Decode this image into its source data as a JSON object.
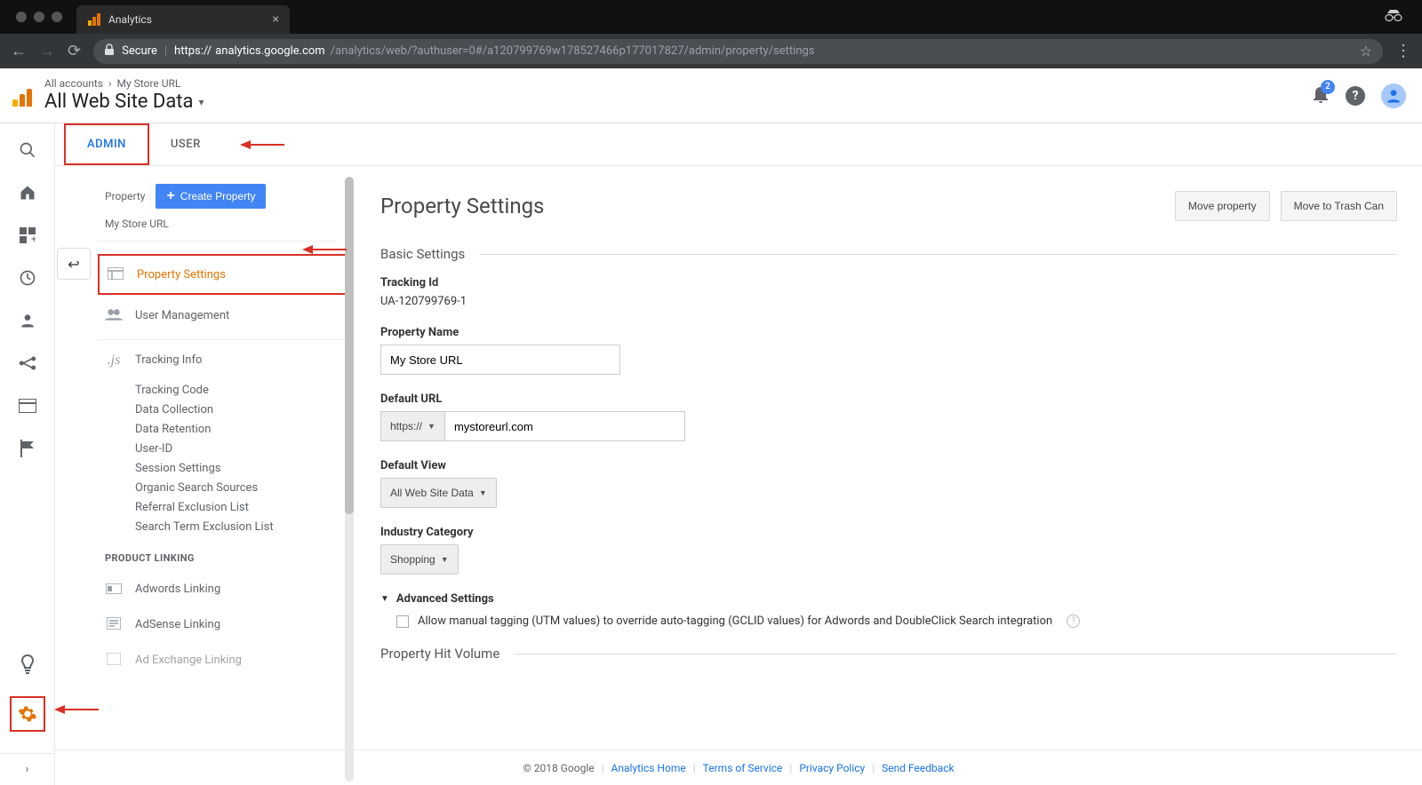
{
  "browser": {
    "tab_title": "Analytics",
    "secure_label": "Secure",
    "url_prefix": "https://",
    "url_host": "analytics.google.com",
    "url_path": "/analytics/web/?authuser=0#/a120799769w178527466p177017827/admin/property/settings"
  },
  "header": {
    "breadcrumb_accounts": "All accounts",
    "breadcrumb_property": "My Store URL",
    "view_name": "All Web Site Data",
    "notif_count": "2"
  },
  "tabs": {
    "admin": "ADMIN",
    "user": "USER"
  },
  "property_col": {
    "label": "Property",
    "create_btn": "Create Property",
    "property_name": "My Store URL",
    "menu": {
      "property_settings": "Property Settings",
      "user_management": "User Management",
      "tracking_info": "Tracking Info",
      "tracking_sub": [
        "Tracking Code",
        "Data Collection",
        "Data Retention",
        "User-ID",
        "Session Settings",
        "Organic Search Sources",
        "Referral Exclusion List",
        "Search Term Exclusion List"
      ],
      "section_product_linking": "PRODUCT LINKING",
      "adwords_linking": "Adwords Linking",
      "adsense_linking": "AdSense Linking",
      "adexchange_linking": "Ad Exchange Linking"
    }
  },
  "main": {
    "title": "Property Settings",
    "move_property": "Move property",
    "move_trash": "Move to Trash Can",
    "basic_settings": "Basic Settings",
    "tracking_id_label": "Tracking Id",
    "tracking_id_value": "UA-120799769-1",
    "property_name_label": "Property Name",
    "property_name_value": "My Store URL",
    "default_url_label": "Default URL",
    "default_url_scheme": "https://",
    "default_url_value": "mystoreurl.com",
    "default_view_label": "Default View",
    "default_view_value": "All Web Site Data",
    "industry_label": "Industry Category",
    "industry_value": "Shopping",
    "advanced_label": "Advanced Settings",
    "advanced_check": "Allow manual tagging (UTM values) to override auto-tagging (GCLID values) for Adwords and DoubleClick Search integration",
    "property_hit": "Property Hit Volume"
  },
  "footer": {
    "copyright": "© 2018 Google",
    "analytics_home": "Analytics Home",
    "tos": "Terms of Service",
    "privacy": "Privacy Policy",
    "feedback": "Send Feedback"
  }
}
